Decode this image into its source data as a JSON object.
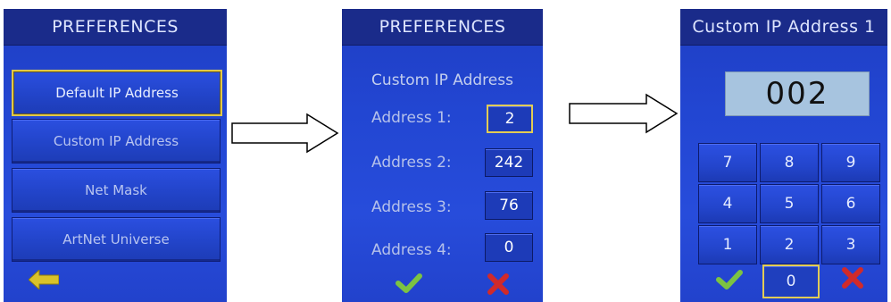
{
  "screen1": {
    "title": "PREFERENCES",
    "items": [
      {
        "label": "Default IP Address"
      },
      {
        "label": "Custom IP Address"
      },
      {
        "label": "Net Mask"
      },
      {
        "label": "ArtNet Universe"
      }
    ],
    "back_icon": "back-arrow-icon"
  },
  "screen2": {
    "title": "PREFERENCES",
    "subtitle": "Custom IP Address",
    "addresses": [
      {
        "label": "Address 1:",
        "value": "2"
      },
      {
        "label": "Address 2:",
        "value": "242"
      },
      {
        "label": "Address 3:",
        "value": "76"
      },
      {
        "label": "Address 4:",
        "value": "0"
      }
    ],
    "confirm_icon": "checkmark-icon",
    "cancel_icon": "cross-icon"
  },
  "screen3": {
    "title": "Custom IP Address 1",
    "display_value": "002",
    "keys": [
      "7",
      "8",
      "9",
      "4",
      "5",
      "6",
      "1",
      "2",
      "3",
      "0"
    ],
    "confirm_icon": "checkmark-icon",
    "cancel_icon": "cross-icon"
  },
  "colors": {
    "screen_blue": "#2246d2",
    "header_blue": "#1a2b8a",
    "highlight_gold": "#e0c84a",
    "check_green": "#7cc342",
    "cross_red": "#d12a2a",
    "back_arrow_yellow": "#d9c22a",
    "display_bg": "#a7c4df"
  }
}
